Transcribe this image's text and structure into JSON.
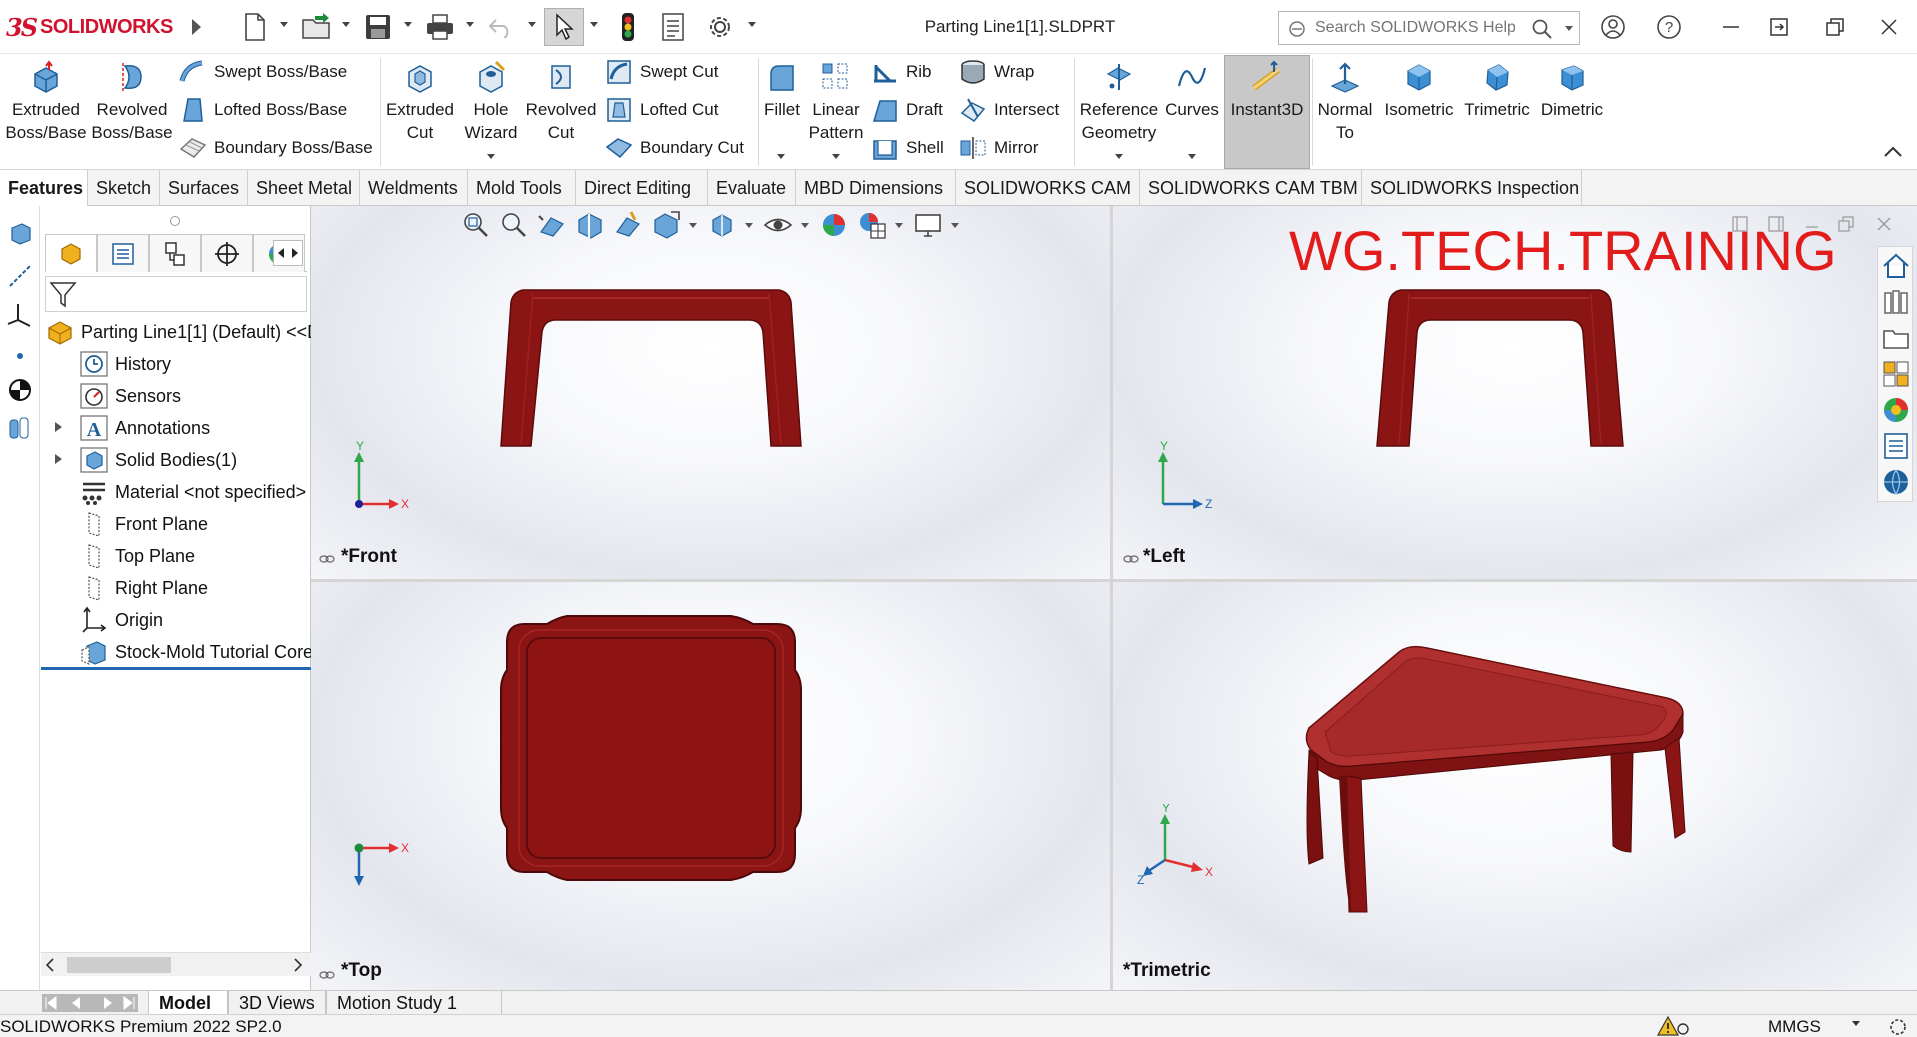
{
  "app": {
    "brand": "SOLIDWORKS",
    "title": "Parting Line1[1].SLDPRT",
    "search_placeholder": "Search SOLIDWORKS Help"
  },
  "ribbon": {
    "extruded_boss": "Extruded\nBoss/Base",
    "revolved_boss": "Revolved\nBoss/Base",
    "swept_boss": "Swept Boss/Base",
    "lofted_boss": "Lofted Boss/Base",
    "boundary_boss": "Boundary Boss/Base",
    "extruded_cut": "Extruded\nCut",
    "hole_wizard": "Hole\nWizard",
    "revolved_cut": "Revolved\nCut",
    "swept_cut": "Swept Cut",
    "lofted_cut": "Lofted Cut",
    "boundary_cut": "Boundary Cut",
    "fillet": "Fillet",
    "linear_pattern": "Linear\nPattern",
    "rib": "Rib",
    "draft": "Draft",
    "shell": "Shell",
    "wrap": "Wrap",
    "intersect": "Intersect",
    "mirror": "Mirror",
    "reference_geometry": "Reference\nGeometry",
    "curves": "Curves",
    "instant3d": "Instant3D",
    "normal_to": "Normal\nTo",
    "isometric": "Isometric",
    "trimetric": "Trimetric",
    "dimetric": "Dimetric"
  },
  "tabs": [
    "Features",
    "Sketch",
    "Surfaces",
    "Sheet Metal",
    "Weldments",
    "Mold Tools",
    "Direct Editing",
    "Evaluate",
    "MBD Dimensions",
    "SOLIDWORKS CAM",
    "SOLIDWORKS CAM TBM",
    "SOLIDWORKS Inspection"
  ],
  "tree": {
    "root": "Parting Line1[1] (Default) <<D",
    "items": [
      "History",
      "Sensors",
      "Annotations",
      "Solid Bodies(1)",
      "Material <not specified>",
      "Front Plane",
      "Top Plane",
      "Right Plane",
      "Origin",
      "Stock-Mold Tutorial Core"
    ]
  },
  "viewports": {
    "front": "*Front",
    "left": "*Left",
    "top": "*Top",
    "trimetric": "*Trimetric"
  },
  "axes": {
    "x": "X",
    "y": "Y",
    "z": "Z"
  },
  "watermark": "WG.TECH.TRAINING",
  "bottom_tabs": [
    "Model",
    "3D Views",
    "Motion Study 1"
  ],
  "status": {
    "product": "SOLIDWORKS Premium 2022 SP2.0",
    "units": "MMGS"
  },
  "colors": {
    "brand_red": "#d1122e",
    "model_red": "#8b1515",
    "watermark_red": "#e21b1b",
    "selection_blue": "#1f67b1"
  }
}
